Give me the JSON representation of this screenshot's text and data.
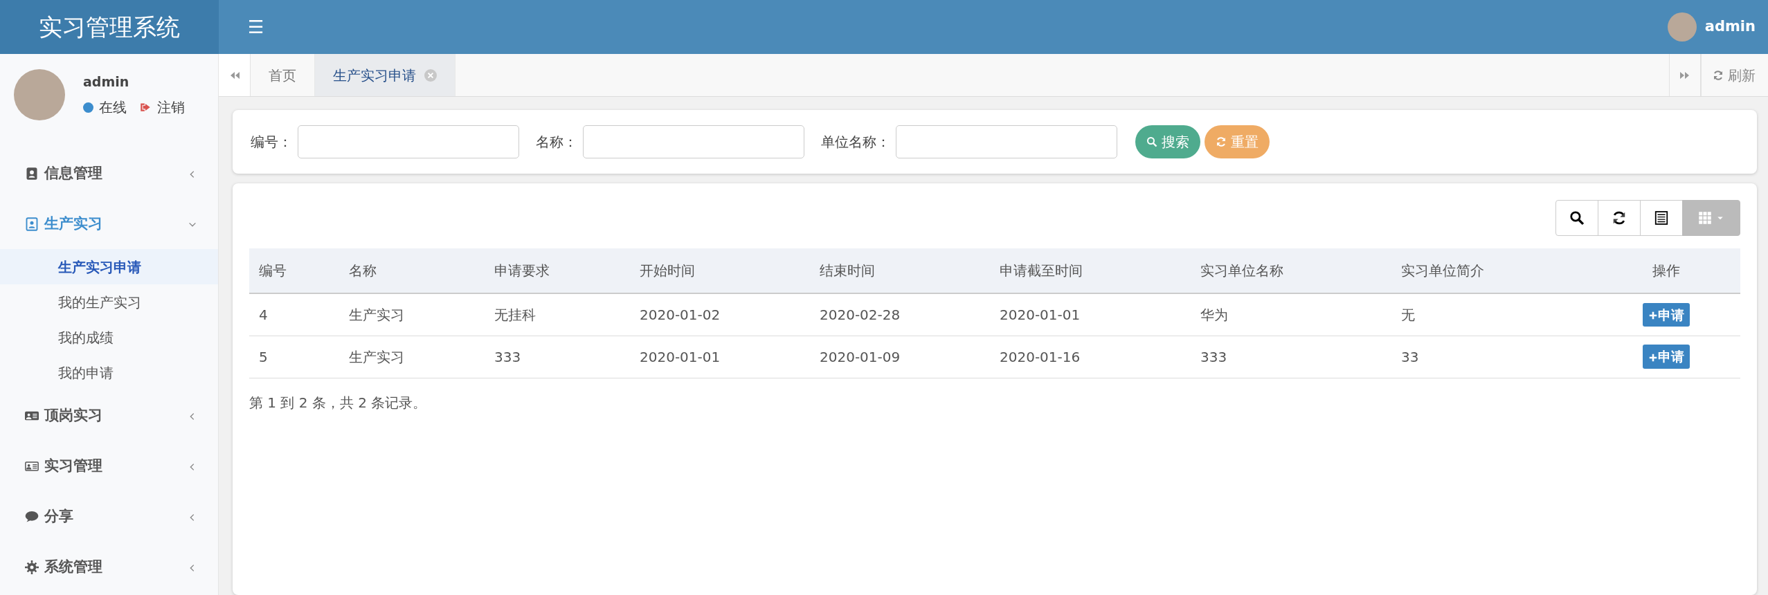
{
  "app_title": "实习管理系统",
  "header": {
    "menu_toggle": "☰",
    "user": "admin"
  },
  "user_panel": {
    "name": "admin",
    "status": "在线",
    "logout": "注销"
  },
  "sidebar": {
    "items": [
      {
        "label": "信息管理",
        "expanded": false
      },
      {
        "label": "生产实习",
        "expanded": true,
        "children": [
          {
            "label": "生产实习申请",
            "selected": true
          },
          {
            "label": "我的生产实习",
            "selected": false
          },
          {
            "label": "我的成绩",
            "selected": false
          },
          {
            "label": "我的申请",
            "selected": false
          }
        ]
      },
      {
        "label": "顶岗实习",
        "expanded": false
      },
      {
        "label": "实习管理",
        "expanded": false
      },
      {
        "label": "分享",
        "expanded": false
      },
      {
        "label": "系统管理",
        "expanded": false
      }
    ]
  },
  "tabs": [
    {
      "label": "首页",
      "selected": false,
      "closable": false
    },
    {
      "label": "生产实习申请",
      "selected": true,
      "closable": true
    }
  ],
  "refresh": "刷新",
  "search_form": {
    "fields": [
      {
        "label": "编号："
      },
      {
        "label": "名称："
      },
      {
        "label": "单位名称："
      }
    ],
    "search_button": "搜索",
    "reset_button": "重置"
  },
  "table": {
    "columns": [
      "编号",
      "名称",
      "申请要求",
      "开始时间",
      "结束时间",
      "申请截至时间",
      "实习单位名称",
      "实习单位简介",
      "操作"
    ],
    "rows": [
      {
        "cells": [
          "4",
          "生产实习",
          "无挂科",
          "2020-01-02",
          "2020-02-28",
          "2020-01-01",
          "华为",
          "无"
        ],
        "action": "申请"
      },
      {
        "cells": [
          "5",
          "生产实习",
          "333",
          "2020-01-01",
          "2020-01-09",
          "2020-01-16",
          "333",
          "33"
        ],
        "action": "申请"
      }
    ],
    "footer": "第 1 到 2 条，共 2 条记录。"
  }
}
